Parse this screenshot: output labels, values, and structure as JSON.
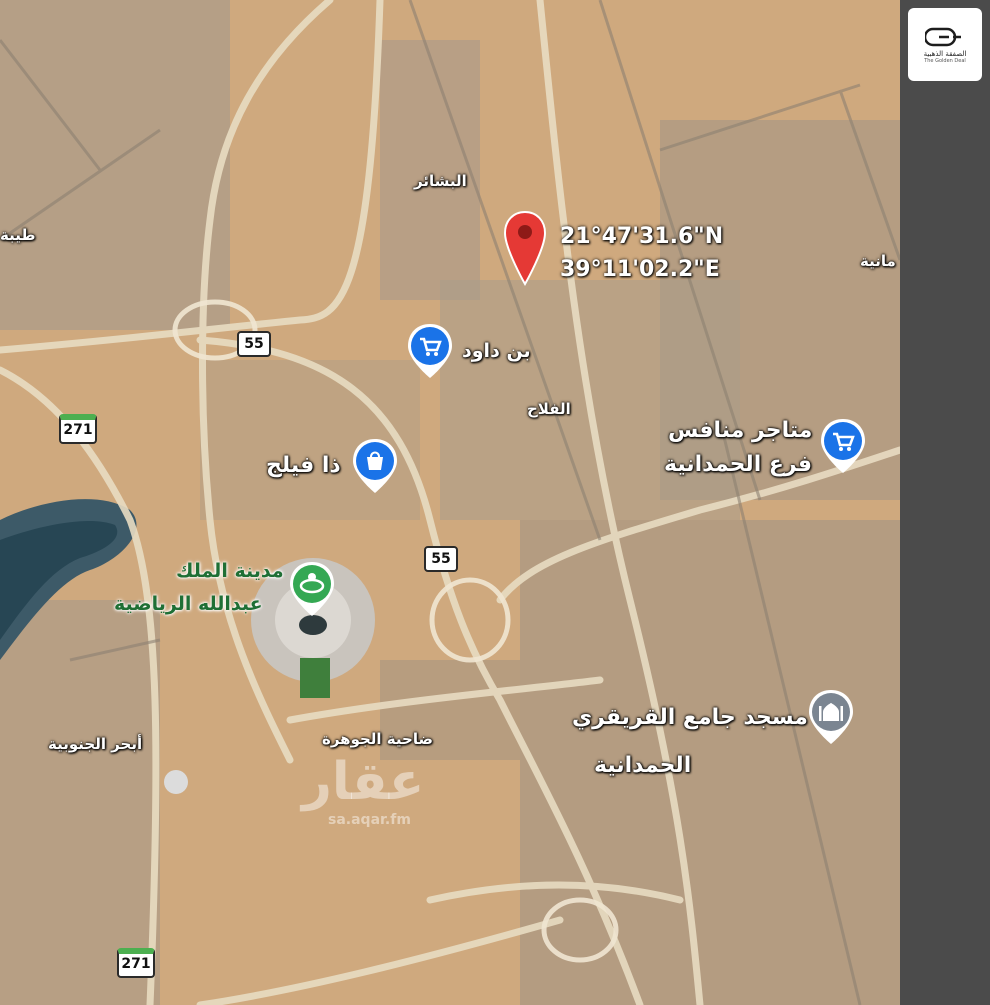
{
  "map": {
    "coordinates": {
      "lat": "21°47'31.6\"N",
      "lon": "39°11'02.2\"E"
    },
    "labels": {
      "bashair": "البشائر",
      "bin_dawood": "بن داود",
      "falah": "الفلاح",
      "munafes_line1": "متاجر منافس",
      "munafes_line2": "فرع الحمدانية",
      "tha_fileej": "ذا فيلج",
      "sports_city_line1": "مدينة الملك",
      "sports_city_line2": "عبدالله الرياضية",
      "mosque_line1": "مسجد جامع القريقري",
      "mosque_line2": "الحمدانية",
      "jawhara": "ضاحية الجوهرة",
      "abhur": "أبحر الجنوبية",
      "taiba": "طيبة",
      "hamdania_edge": "مانية"
    },
    "road_shields": {
      "r55_a": "55",
      "r55_b": "55",
      "r271_a": "271",
      "r271_b": "271"
    },
    "watermark": {
      "arabic": "عقار",
      "url": "sa.aqar.fm"
    },
    "colors": {
      "pin": "#e53935",
      "poi_blue": "#1a73e8",
      "poi_green": "#34a853",
      "poi_gray": "#7b8591"
    },
    "icons": {
      "pin": "location-pin-icon",
      "cart": "shopping-cart-icon",
      "bag": "shopping-bag-icon",
      "stadium": "stadium-icon",
      "mosque": "mosque-icon"
    }
  },
  "logo": {
    "arabic": "الصفقة الذهبية",
    "english": "The Golden Deal"
  }
}
